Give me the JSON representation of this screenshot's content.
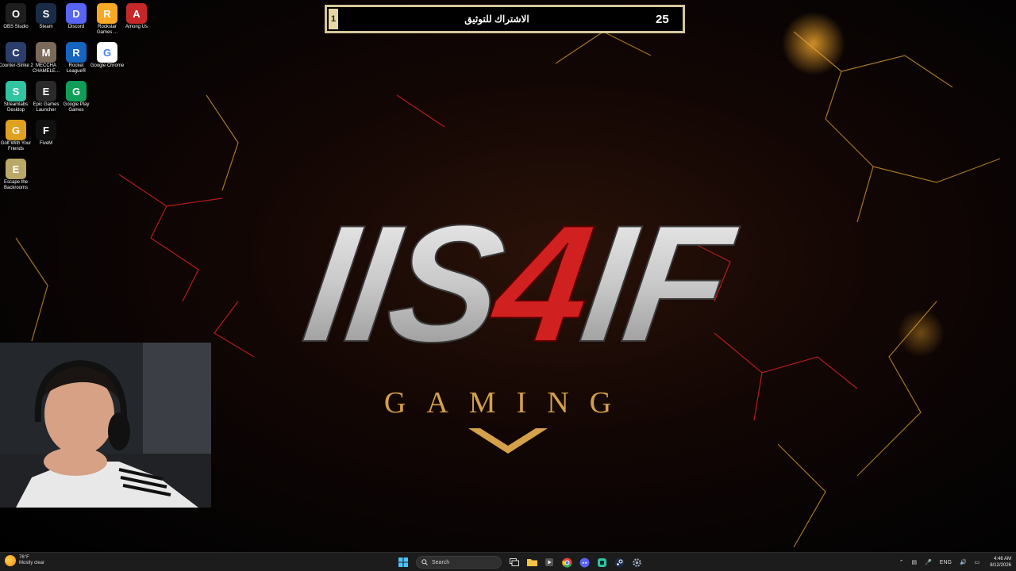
{
  "desktop_icons": [
    {
      "label": "OBS Studio",
      "icon": "obs-icon",
      "color": "#1e1e1e"
    },
    {
      "label": "Steam",
      "icon": "steam-icon",
      "color": "#1a2b45"
    },
    {
      "label": "Discord",
      "icon": "discord-icon",
      "color": "#5865f2"
    },
    {
      "label": "Rockstar Games ...",
      "icon": "rockstar-icon",
      "color": "#f9a825"
    },
    {
      "label": "Among Us",
      "icon": "among-us-icon",
      "color": "#c62828"
    },
    {
      "label": "Counter-Strike 2",
      "icon": "cs2-icon",
      "color": "#2a3d6b"
    },
    {
      "label": "MECCHA CHAMELE...",
      "icon": "meccha-chameleon-icon",
      "color": "#7a6a5a"
    },
    {
      "label": "Rocket League®",
      "icon": "rocket-league-icon",
      "color": "#1565c0"
    },
    {
      "label": "Google Chrome",
      "icon": "chrome-icon",
      "color": "#ffffff"
    },
    {
      "label": "Streamlabs Desktop",
      "icon": "streamlabs-icon",
      "color": "#31c3a2"
    },
    {
      "label": "Epic Games Launcher",
      "icon": "epic-games-icon",
      "color": "#2a2a2a"
    },
    {
      "label": "Google Play Games",
      "icon": "google-play-games-icon",
      "color": "#0f9d58"
    },
    {
      "label": "Golf With Your Friends",
      "icon": "golf-icon",
      "color": "#e0a020"
    },
    {
      "label": "FiveM",
      "icon": "fivem-icon",
      "color": "#111111"
    },
    {
      "label": "Escape the Backrooms",
      "icon": "escape-backrooms-icon",
      "color": "#b9a868"
    }
  ],
  "goal": {
    "current": "1",
    "label": "الاشتراك للتوثيق",
    "target": "25",
    "progress": 0.04
  },
  "wallpaper": {
    "logo_text": "IIS4IF",
    "subtitle": "GAMING",
    "accent": "#d12020",
    "gold": "#d4a04a"
  },
  "taskbar": {
    "weather_temp": "76°F",
    "weather_desc": "Mostly clear",
    "search_placeholder": "Search",
    "language": "ENG",
    "time": "4:46 AM",
    "date": "8/12/2026"
  }
}
